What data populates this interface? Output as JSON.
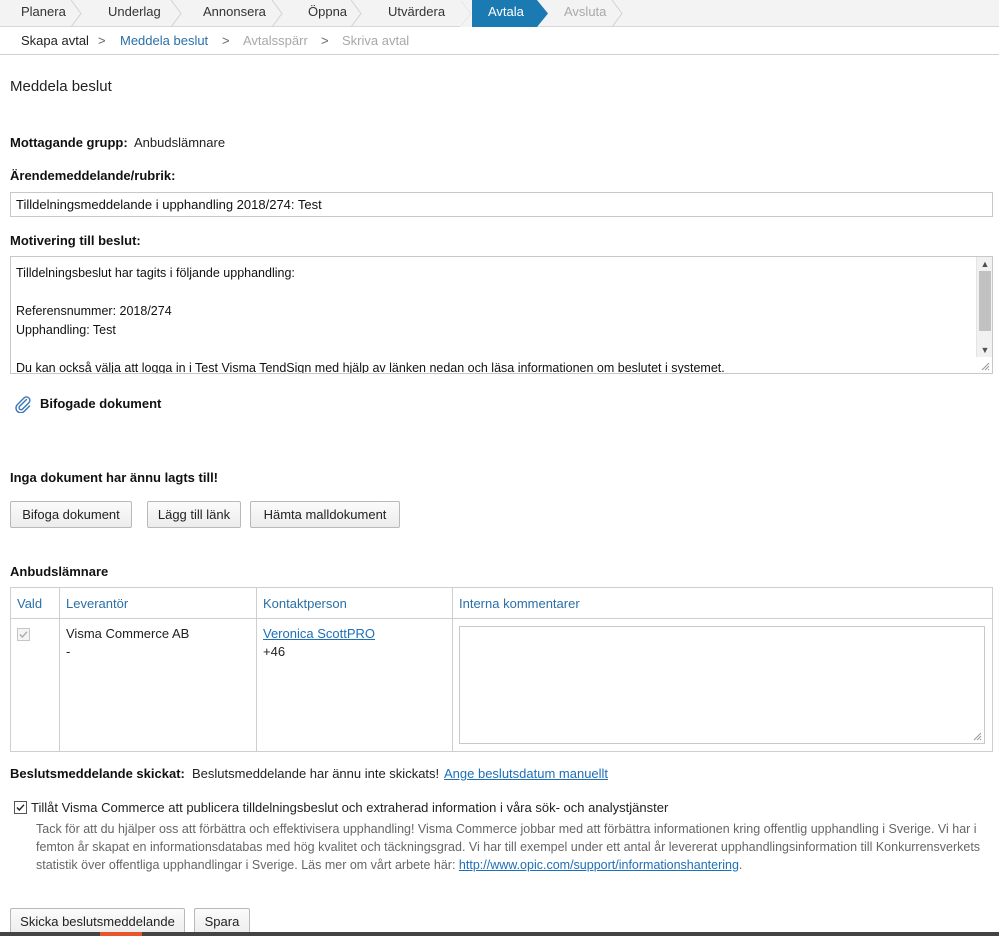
{
  "steps": [
    {
      "label": "Planera",
      "state": "done"
    },
    {
      "label": "Underlag",
      "state": "done"
    },
    {
      "label": "Annonsera",
      "state": "done"
    },
    {
      "label": "Öppna",
      "state": "done"
    },
    {
      "label": "Utvärdera",
      "state": "done"
    },
    {
      "label": "Avtala",
      "state": "active"
    },
    {
      "label": "Avsluta",
      "state": "disabled"
    }
  ],
  "subnav": {
    "items": [
      "Skapa avtal",
      "Meddela beslut",
      "Avtalsspärr",
      "Skriva avtal"
    ],
    "separator": ">"
  },
  "page_title": "Meddela beslut",
  "recipient": {
    "label": "Mottagande grupp:",
    "value": "Anbudslämnare"
  },
  "subject": {
    "label": "Ärendemeddelande/rubrik:",
    "value": "Tilldelningsmeddelande i upphandling 2018/274: Test"
  },
  "motivation": {
    "label": "Motivering till beslut:",
    "value": "Tilldelningsbeslut har tagits i följande upphandling:\n\nReferensnummer: 2018/274\nUpphandling: Test\n\nDu kan också välja att logga in i Test Visma TendSign med hjälp av länken nedan och läsa informationen om beslutet i systemet."
  },
  "attachments": {
    "heading": "Bifogade dokument",
    "empty_text": "Inga dokument har ännu lagts till!",
    "buttons": [
      "Bifoga dokument",
      "Lägg till länk",
      "Hämta malldokument"
    ]
  },
  "bidders": {
    "heading": "Anbudslämnare",
    "columns": [
      "Vald",
      "Leverantör",
      "Kontaktperson",
      "Interna kommentarer"
    ],
    "rows": [
      {
        "supplier": "Visma Commerce AB",
        "supplier_sub": "-",
        "contact": "Veronica ScottPRO",
        "phone": "+46",
        "comment": ""
      }
    ]
  },
  "sent": {
    "label": "Beslutsmeddelande skickat:",
    "value": "Beslutsmeddelande har ännu inte skickats!",
    "link": "Ange beslutsdatum manuellt"
  },
  "consent": {
    "checked": true,
    "label": "Tillåt Visma Commerce att publicera tilldelningsbeslut och extraherad information i våra sök- och analystjänster",
    "note": "Tack för att du hjälper oss att förbättra och effektivisera upphandling! Visma Commerce jobbar med att förbättra informationen kring offentlig upphandling i Sverige. Vi har i femton år skapat en informationsdatabas med hög kvalitet och täckningsgrad. Vi har till exempel under ett antal år levererat upphandlingsinformation till Konkurrensverkets statistik över offentliga upphandlingar i Sverige. Läs mer om vårt arbete här: ",
    "note_link": "http://www.opic.com/support/informationshantering",
    "note_end": "."
  },
  "actions": {
    "send": "Skicka beslutsmeddelande",
    "save": "Spara"
  },
  "colors": {
    "accent": "#1c7ab3",
    "link": "#1d6fb8",
    "muted": "#a8a8a8"
  }
}
